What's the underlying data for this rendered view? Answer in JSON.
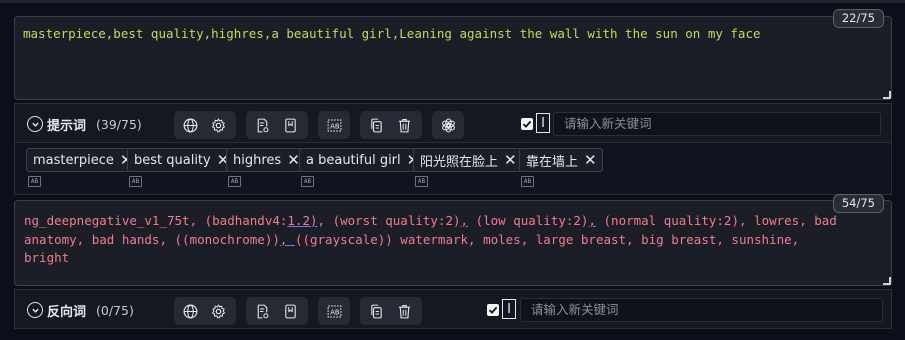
{
  "positive": {
    "counter": "22/75",
    "text": "masterpiece,best quality,highres,a beautiful girl,Leaning against the wall with the sun on my face",
    "toolbar": {
      "label": "提示词",
      "count": "(39/75)",
      "keyword_placeholder": "请输入新关键词"
    },
    "tags": [
      {
        "label": "masterpiece"
      },
      {
        "label": "best quality"
      },
      {
        "label": "highres"
      },
      {
        "label": "a beautiful girl"
      },
      {
        "label": "阳光照在脸上"
      },
      {
        "label": "靠在墙上"
      }
    ]
  },
  "negative": {
    "counter": "54/75",
    "text_parts": {
      "p1": "ng_deepnegative_v1_75t, (badhandv4:",
      "u1": "1.2)",
      "p2": ", (worst quality:2)",
      "u2": ",",
      "p3": " (low quality:2)",
      "u3": ",",
      "p4": " (normal quality:2), lowres, bad\nanatomy, bad hands, ((monochrome))",
      "u4": ", ",
      "p5": "((grayscale)) watermark, moles, large breast, big breast, sunshine,\nbright"
    },
    "toolbar": {
      "label": "反向词",
      "count": "(0/75)",
      "keyword_placeholder": "请输入新关键词"
    }
  },
  "icons": [
    "chevron-down-icon",
    "globe-icon",
    "gear-icon",
    "file-settings-icon",
    "bookmark-icon",
    "ab-icon",
    "copy-icon",
    "trash-icon",
    "openai-icon",
    "checkbox-icon",
    "text-cursor-icon",
    "close-icon"
  ],
  "colors": {
    "positive_text": "#c6d85a",
    "negative_text": "#f07b8f",
    "background": "#0b0f19"
  }
}
